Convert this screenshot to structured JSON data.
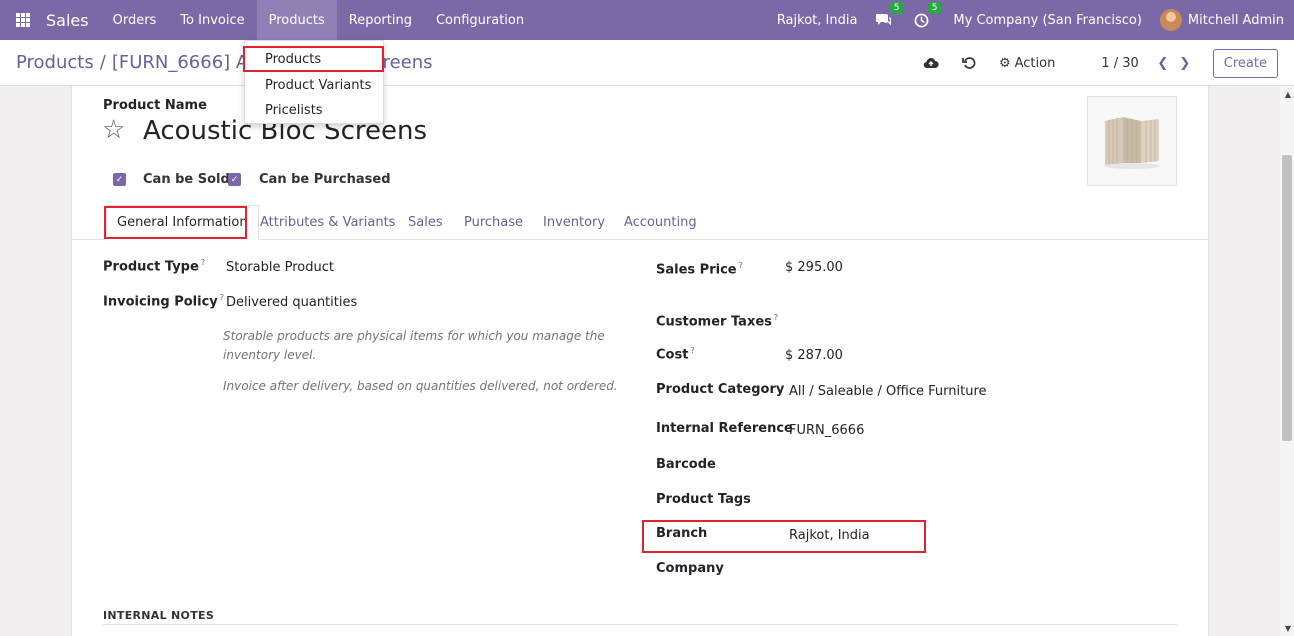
{
  "navbar": {
    "app_name": "Sales",
    "menu": [
      "Orders",
      "To Invoice",
      "Products",
      "Reporting",
      "Configuration"
    ],
    "branch": "Rajkot, India",
    "messages_count": "5",
    "activities_count": "5",
    "company": "My Company (San Francisco)",
    "user": "Mitchell Admin"
  },
  "control": {
    "breadcrumb_parent": "Products",
    "breadcrumb_current": "[FURN_6666] Acoustic Bloc Screens",
    "action_label": "Action",
    "pager": "1 / 30",
    "create_label": "Create"
  },
  "dropdown": {
    "items": [
      "Products",
      "Product Variants",
      "Pricelists"
    ]
  },
  "form": {
    "product_name_label": "Product Name",
    "product_name": "Acoustic Bloc Screens",
    "can_be_sold": "Can be Sold",
    "can_be_purchased": "Can be Purchased",
    "tabs": [
      "General Information",
      "Attributes & Variants",
      "Sales",
      "Purchase",
      "Inventory",
      "Accounting"
    ],
    "left": {
      "product_type_label": "Product Type",
      "product_type": "Storable Product",
      "invoicing_policy_label": "Invoicing Policy",
      "invoicing_policy": "Delivered quantities",
      "help_line_1": "Storable products are physical items for which you manage the",
      "help_line_2": "inventory level.",
      "help_line_3": "Invoice after delivery, based on quantities delivered, not ordered."
    },
    "right": {
      "sales_price_label": "Sales Price",
      "sales_price": "$ 295.00",
      "customer_taxes_label": "Customer Taxes",
      "cost_label": "Cost",
      "cost": "$ 287.00",
      "product_category_label": "Product Category",
      "product_category": "All / Saleable / Office Furniture",
      "internal_reference_label": "Internal Reference",
      "internal_reference": "FURN_6666",
      "barcode_label": "Barcode",
      "product_tags_label": "Product Tags",
      "branch_label": "Branch",
      "branch": "Rajkot, India",
      "company_label": "Company"
    },
    "internal_notes_title": "INTERNAL NOTES"
  },
  "icons": {
    "help_marker": "?",
    "star": "☆",
    "check": "✓",
    "prev": "❮",
    "next": "❯",
    "gear": "⚙"
  }
}
